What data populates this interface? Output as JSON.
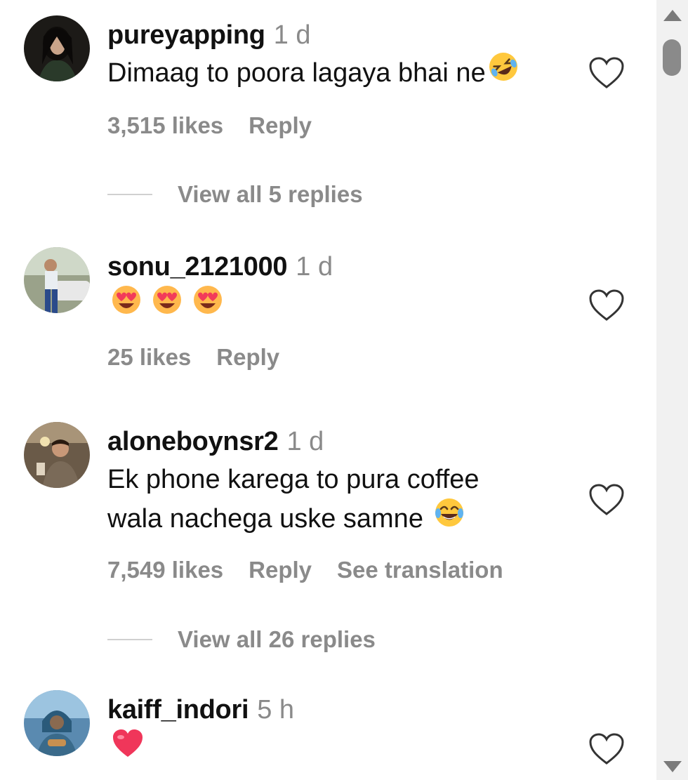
{
  "comments": [
    {
      "username": "pureyapping",
      "time": "1 d",
      "text_lines": [
        "Dimaag to poora lagaya bhai ne"
      ],
      "trailing_emoji": "rolling-on-floor-laughing",
      "likes": "3,515 likes",
      "reply": "Reply",
      "view_replies": "View all 5 replies"
    },
    {
      "username": "sonu_2121000",
      "time": "1 d",
      "emoji_row": [
        "heart-eyes",
        "heart-eyes",
        "heart-eyes"
      ],
      "likes": "25 likes",
      "reply": "Reply"
    },
    {
      "username": "aloneboynsr2",
      "time": "1 d",
      "text_lines": [
        "Ek phone karega to pura coffee",
        "wala nachega uske samne"
      ],
      "trailing_emoji": "tears-of-joy",
      "likes": "7,549 likes",
      "reply": "Reply",
      "translation": "See translation",
      "view_replies": "View all 26 replies"
    },
    {
      "username": "kaiff_indori",
      "time": "5 h",
      "emoji_row": [
        "red-heart"
      ]
    }
  ],
  "colors": {
    "text": "#111111",
    "muted": "#8a8a8a",
    "scrollbar_track": "#f1f1f1",
    "scrollbar_thumb": "#8a8a8a"
  }
}
